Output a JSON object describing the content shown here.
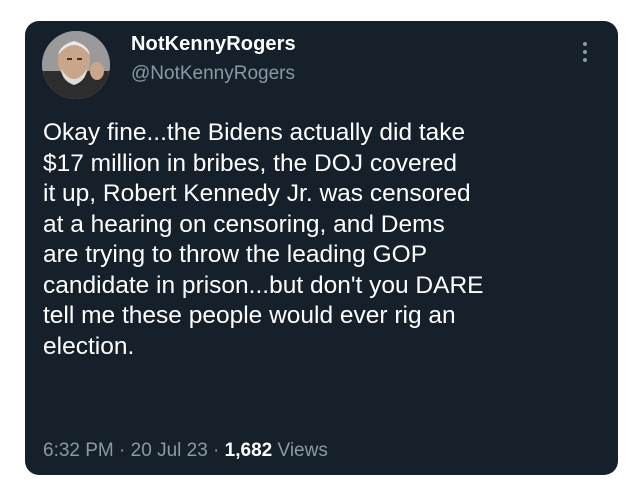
{
  "author": {
    "display_name": "NotKennyRogers",
    "handle": "@NotKennyRogers"
  },
  "tweet": {
    "lines": [
      "Okay fine...the Bidens actually did take",
      "$17 million in bribes, the DOJ covered",
      "it up, Robert Kennedy Jr. was censored",
      "at a hearing on censoring, and Dems",
      "are trying to throw the leading GOP",
      "candidate in prison...but don't you DARE",
      "tell me these people would ever rig an",
      "election."
    ]
  },
  "meta": {
    "time": "6:32 PM",
    "separator": " · ",
    "date": "20 Jul 23",
    "views_count": "1,682",
    "views_label": " Views"
  },
  "icons": {
    "more": "more-options-icon"
  },
  "colors": {
    "card_background": "#15202b",
    "primary_text": "#ffffff",
    "secondary_text": "#8b98a5"
  }
}
